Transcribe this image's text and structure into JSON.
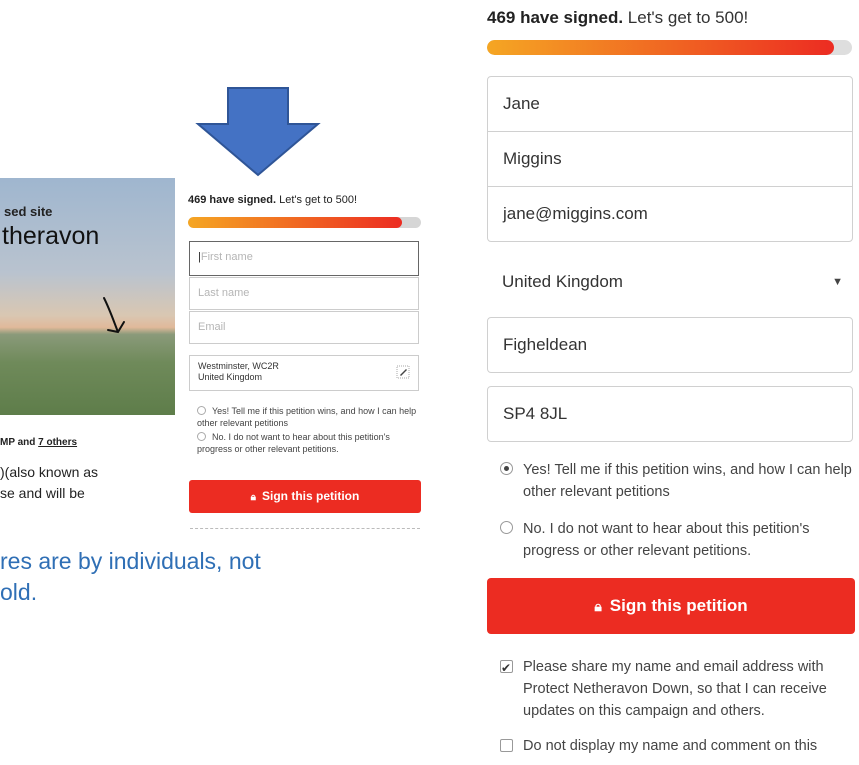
{
  "left": {
    "photo_caption_1": "sed site",
    "photo_caption_2": "theravon",
    "mp_line_prefix": "MP and ",
    "mp_line_link": "7 others",
    "body_line_1": ")(also known as",
    "body_line_2": "se and will be",
    "blue_line_1": "res are by individuals, not",
    "blue_line_2": "old."
  },
  "small_form": {
    "count_bold": "469 have signed.",
    "count_rest": " Let's get to 500!",
    "progress": 0.92,
    "first_name_placeholder": "First name",
    "last_name_placeholder": "Last name",
    "email_placeholder": "Email",
    "address_line_1": "Westminster, WC2R",
    "address_line_2": "United Kingdom",
    "radio_yes": "Yes! Tell me if this petition wins, and how I can help other relevant petitions",
    "radio_no": "No. I do not want to hear about this petition's progress or other relevant petitions.",
    "sign_label": "Sign this petition"
  },
  "big_form": {
    "count_bold": "469 have signed.",
    "count_rest": " Let's get to 500!",
    "progress": 0.95,
    "first_name": "Jane",
    "last_name": "Miggins",
    "email": "jane@miggins.com",
    "country": "United Kingdom",
    "town": "Figheldean",
    "postcode": "SP4 8JL",
    "radio_yes": "Yes! Tell me if this petition wins, and how I can help other relevant petitions",
    "radio_no": "No. I do not want to hear about this petition's progress or other relevant petitions.",
    "sign_label": "Sign this petition",
    "share_consent": "Please share my name and email address with Protect Netheravon Down, so that I can receive updates on this campaign and others.",
    "hide_name": "Do not display my name and comment on this"
  },
  "colors": {
    "accent_red": "#ec2c22",
    "progress_orange": "#f5a623",
    "arrow_blue": "#4472c4",
    "annotation_blue": "#2f6fb5"
  },
  "icons": {
    "lock": "lock-icon",
    "edit": "edit-icon",
    "down_arrow": "down-arrow-icon",
    "caret": "caret-down-icon"
  }
}
